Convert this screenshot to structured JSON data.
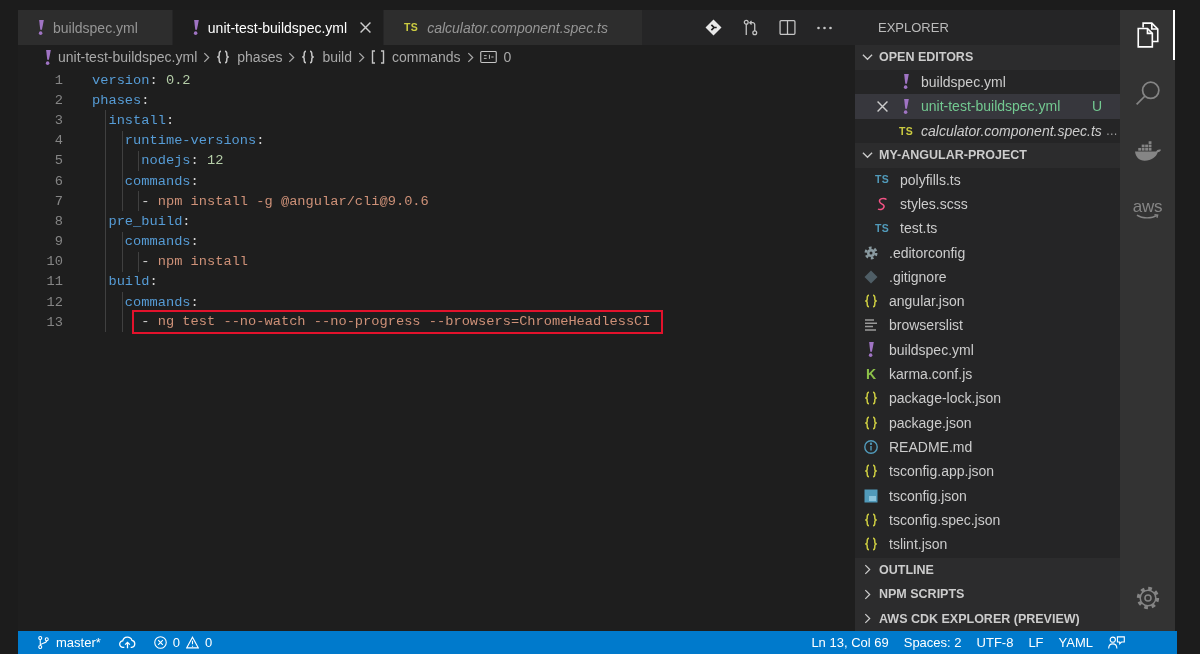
{
  "editor": {
    "tabs": [
      {
        "label": "buildspec.yml",
        "kind": "yaml",
        "selected": false,
        "preview": false
      },
      {
        "label": "unit-test-buildspec.yml",
        "kind": "yaml",
        "selected": true,
        "preview": false
      },
      {
        "label": "calculator.component.spec.ts",
        "kind": "spec",
        "icon_text": "TS",
        "selected": false,
        "preview": true
      }
    ],
    "breadcrumb": [
      {
        "kind": "file",
        "label": "unit-test-buildspec.yml"
      },
      {
        "kind": "object",
        "label": "phases"
      },
      {
        "kind": "object",
        "label": "build"
      },
      {
        "kind": "array",
        "label": "commands"
      },
      {
        "kind": "string",
        "label": "0"
      }
    ],
    "lines": [
      {
        "number": "1",
        "highlighted": false,
        "tokens": [
          {
            "kind": "key",
            "text": "version"
          },
          {
            "kind": "punct",
            "text": ": "
          },
          {
            "kind": "number",
            "text": "0.2"
          }
        ]
      },
      {
        "number": "2",
        "highlighted": false,
        "tokens": [
          {
            "kind": "key",
            "text": "phases"
          },
          {
            "kind": "punct",
            "text": ":"
          }
        ]
      },
      {
        "number": "3",
        "highlighted": false,
        "tokens": [
          {
            "kind": "key",
            "text": "  install"
          },
          {
            "kind": "punct",
            "text": ":"
          }
        ]
      },
      {
        "number": "4",
        "highlighted": false,
        "tokens": [
          {
            "kind": "key",
            "text": "    runtime-versions"
          },
          {
            "kind": "punct",
            "text": ":"
          }
        ]
      },
      {
        "number": "5",
        "highlighted": false,
        "tokens": [
          {
            "kind": "key",
            "text": "      nodejs"
          },
          {
            "kind": "punct",
            "text": ": "
          },
          {
            "kind": "number",
            "text": "12"
          }
        ]
      },
      {
        "number": "6",
        "highlighted": false,
        "tokens": [
          {
            "kind": "key",
            "text": "    commands"
          },
          {
            "kind": "punct",
            "text": ":"
          }
        ]
      },
      {
        "number": "7",
        "highlighted": false,
        "tokens": [
          {
            "kind": "punct",
            "text": "      - "
          },
          {
            "kind": "string",
            "text": "npm install -g @angular/cli@9.0.6"
          }
        ]
      },
      {
        "number": "8",
        "highlighted": false,
        "tokens": [
          {
            "kind": "key",
            "text": "  pre_build"
          },
          {
            "kind": "punct",
            "text": ":"
          }
        ]
      },
      {
        "number": "9",
        "highlighted": false,
        "tokens": [
          {
            "kind": "key",
            "text": "    commands"
          },
          {
            "kind": "punct",
            "text": ":"
          }
        ]
      },
      {
        "number": "10",
        "highlighted": false,
        "tokens": [
          {
            "kind": "punct",
            "text": "      - "
          },
          {
            "kind": "string",
            "text": "npm install"
          }
        ]
      },
      {
        "number": "11",
        "highlighted": false,
        "tokens": [
          {
            "kind": "key",
            "text": "  build"
          },
          {
            "kind": "punct",
            "text": ":"
          }
        ]
      },
      {
        "number": "12",
        "highlighted": false,
        "tokens": [
          {
            "kind": "key",
            "text": "    commands"
          },
          {
            "kind": "punct",
            "text": ":"
          }
        ]
      },
      {
        "number": "13",
        "highlighted": true,
        "tokens": [
          {
            "kind": "punct",
            "text": "      - "
          },
          {
            "kind": "string",
            "text": "ng test --no-watch --no-progress --browsers=ChromeHeadlessCI"
          }
        ]
      }
    ]
  },
  "sidebar": {
    "title": "EXPLORER",
    "sections": [
      {
        "title": "OPEN EDITORS",
        "kind": "open-editors",
        "expanded": true,
        "items": [
          {
            "name": "buildspec.yml",
            "kind": "yaml",
            "selected": false,
            "preview": false
          },
          {
            "name": "unit-test-buildspec.yml",
            "kind": "yaml",
            "selected": true,
            "preview": false,
            "status": "U"
          },
          {
            "name": "calculator.component.spec.ts",
            "kind": "spec",
            "icon_text": "TS",
            "selected": false,
            "preview": true,
            "description": "…"
          }
        ]
      },
      {
        "title": "MY-ANGULAR-PROJECT",
        "kind": "tree",
        "expanded": true,
        "items": [
          {
            "children": [
              {
                "name": "polyfills.ts",
                "kind": "typescript",
                "icon_text": "TS"
              },
              {
                "name": "styles.scss",
                "kind": "sass"
              },
              {
                "name": "test.ts",
                "kind": "typescript",
                "icon_text": "TS"
              }
            ]
          },
          {
            "name": ".editorconfig",
            "kind": "config"
          },
          {
            "name": ".gitignore",
            "kind": "git"
          },
          {
            "name": "angular.json",
            "kind": "json"
          },
          {
            "name": "browserslist",
            "kind": "text"
          },
          {
            "name": "buildspec.yml",
            "kind": "yaml"
          },
          {
            "name": "karma.conf.js",
            "kind": "karma",
            "icon_text": "K"
          },
          {
            "name": "package-lock.json",
            "kind": "json"
          },
          {
            "name": "package.json",
            "kind": "json"
          },
          {
            "name": "README.md",
            "kind": "readme"
          },
          {
            "name": "tsconfig.app.json",
            "kind": "json"
          },
          {
            "name": "tsconfig.json",
            "kind": "tsconfig"
          },
          {
            "name": "tsconfig.spec.json",
            "kind": "json"
          },
          {
            "name": "tslint.json",
            "kind": "json"
          }
        ]
      },
      {
        "title": "OUTLINE",
        "expanded": false
      },
      {
        "title": "NPM SCRIPTS",
        "expanded": false
      },
      {
        "title": "AWS CDK EXPLORER (PREVIEW)",
        "expanded": false
      }
    ]
  },
  "activity_bar": [
    {
      "kind": "explorer",
      "selected": true
    },
    {
      "kind": "search",
      "selected": false
    },
    {
      "kind": "docker",
      "selected": false
    },
    {
      "kind": "aws",
      "label": "aws",
      "selected": false
    },
    {
      "kind": "settings",
      "selected": false
    }
  ],
  "status_bar": {
    "left": [
      {
        "kind": "branch",
        "label": "master*"
      },
      {
        "kind": "sync"
      },
      {
        "kind": "problems",
        "errors": "0",
        "warnings": "0"
      }
    ],
    "right": [
      {
        "kind": "text",
        "label": "Ln 13, Col 69"
      },
      {
        "kind": "text",
        "label": "Spaces: 2"
      },
      {
        "kind": "text",
        "label": "UTF-8"
      },
      {
        "kind": "text",
        "label": "LF"
      },
      {
        "kind": "text",
        "label": "YAML"
      },
      {
        "kind": "feedback"
      }
    ]
  }
}
